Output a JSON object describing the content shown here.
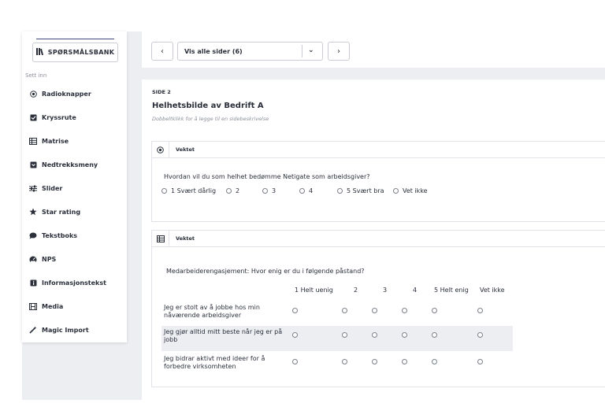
{
  "sidebar": {
    "question_bank_label": "SPØRSMÅLSBANK",
    "section_label": "Sett inn",
    "items": [
      {
        "label": "Radioknapper",
        "icon": "radio-icon"
      },
      {
        "label": "Kryssrute",
        "icon": "checkbox-icon"
      },
      {
        "label": "Matrise",
        "icon": "matrix-icon"
      },
      {
        "label": "Nedtrekksmeny",
        "icon": "dropdown-icon"
      },
      {
        "label": "Slider",
        "icon": "slider-icon"
      },
      {
        "label": "Star rating",
        "icon": "star-icon"
      },
      {
        "label": "Tekstboks",
        "icon": "chat-icon"
      },
      {
        "label": "NPS",
        "icon": "gauge-icon"
      },
      {
        "label": "Informasjonstekst",
        "icon": "info-icon"
      },
      {
        "label": "Media",
        "icon": "film-icon"
      },
      {
        "label": "Magic Import",
        "icon": "magic-wand-icon"
      }
    ]
  },
  "nav": {
    "prev": "‹",
    "next": "›",
    "page_select": "Vis alle sider (6)",
    "chevron": "⌄"
  },
  "page": {
    "side_label": "SIDE 2",
    "title": "Helhetsbilde av Bedrift A",
    "description": "Dobbeltklikk for å legge til en sidebeskrivelse"
  },
  "q1": {
    "header": "Vektet",
    "text": "Hvordan vil du som helhet bedømme Netigate som arbeidsgiver?",
    "options": [
      "1 Svært dårlig",
      "2",
      "3",
      "4",
      "5 Svært bra",
      "Vet ikke"
    ]
  },
  "q2": {
    "header": "Vektet",
    "text": "Medarbeiderengasjement: Hvor enig er du i følgende påstand?",
    "columns": [
      "1 Helt uenig",
      "2",
      "3",
      "4",
      "5 Helt enig",
      "Vet ikke"
    ],
    "rows": [
      "Jeg er stolt av å jobbe hos min nåværende arbeidsgiver",
      "Jeg gjør alltid mitt beste når jeg er på jobb",
      "Jeg bidrar aktivt med ideer for å forbedre virksomheten"
    ]
  },
  "colors": {
    "accent": "#3d4a7a",
    "canvas": "#eceef2",
    "text": "#2a2f3a"
  }
}
